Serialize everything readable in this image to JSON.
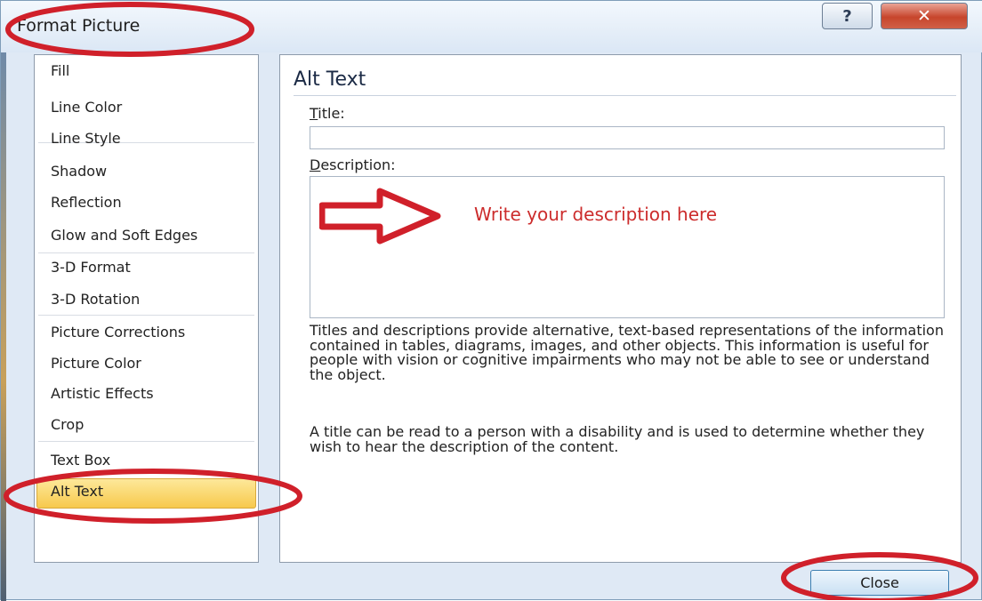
{
  "window": {
    "title": "Format Picture",
    "help_icon": "help-question-icon",
    "close_icon": "close-x-icon"
  },
  "sidebar": {
    "items": [
      {
        "label": "Fill"
      },
      {
        "label": "Line Color"
      },
      {
        "label": "Line Style"
      },
      {
        "label": "Shadow"
      },
      {
        "label": "Reflection"
      },
      {
        "label": "Glow and Soft Edges"
      },
      {
        "label": "3-D Format"
      },
      {
        "label": "3-D Rotation"
      },
      {
        "label": "Picture Corrections"
      },
      {
        "label": "Picture Color"
      },
      {
        "label": "Artistic Effects"
      },
      {
        "label": "Crop"
      },
      {
        "label": "Text Box"
      },
      {
        "label": "Alt Text",
        "selected": true
      }
    ]
  },
  "main": {
    "heading": "Alt Text",
    "title_field": {
      "label_access_key": "T",
      "label_rest": "itle:",
      "value": ""
    },
    "description_field": {
      "label_access_key": "D",
      "label_rest": "escription:",
      "value": ""
    },
    "annotation_text": "Write your description here",
    "help_paragraph_1": "Titles and descriptions provide alternative, text-based representations of the information contained in tables, diagrams, images, and other objects. This information is useful for people with vision or cognitive impairments who may not be able to see or understand the object.",
    "help_paragraph_2": "A title can be read to a person with a disability and is used to determine whether they wish to hear the description of the content."
  },
  "footer": {
    "close_label": "Close"
  },
  "colors": {
    "annotation_red": "#d0202a",
    "selected_item": "#f7c94c",
    "dialog_bg": "#dfe9f5"
  }
}
